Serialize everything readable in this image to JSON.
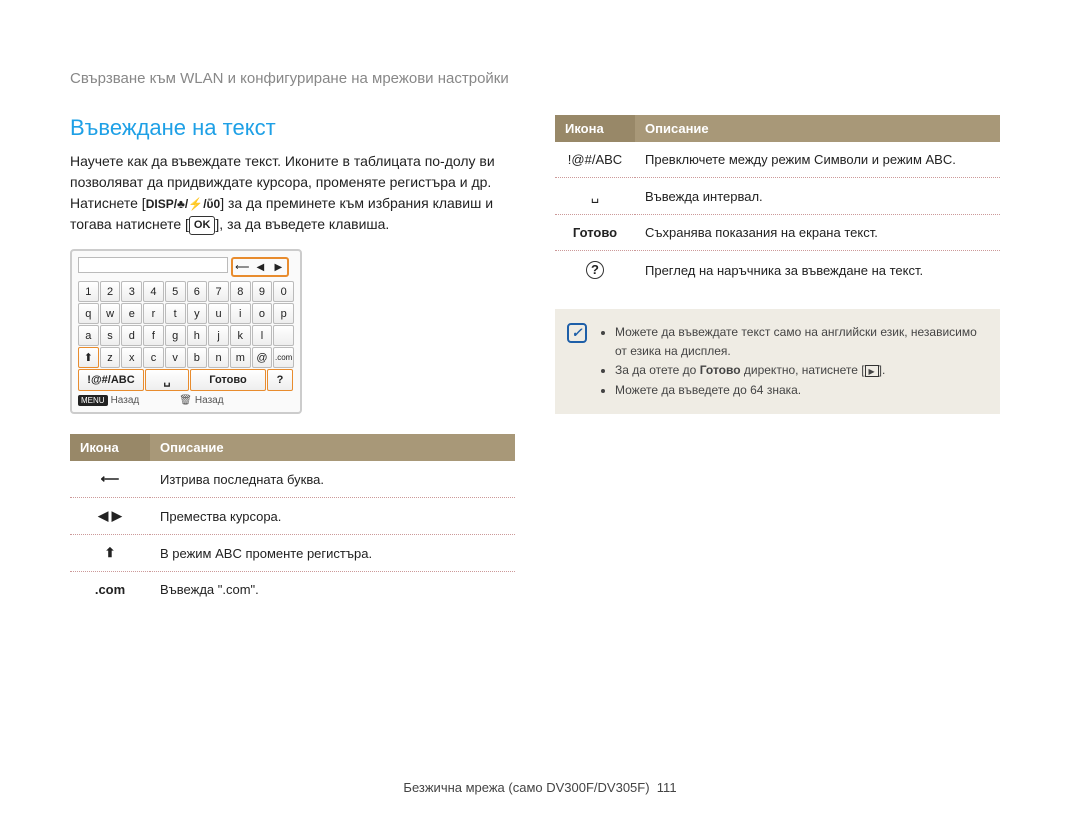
{
  "header": "Свързване към WLAN и конфигуриране на мрежови настройки",
  "title": "Въвеждане на текст",
  "intro_a": "Научете как да въвеждате текст. Иконите в таблицата по-долу ви позволяват да придвиждате курсора, променяте регистъра и др. Натиснете [",
  "intro_b": "] за да преминете към избрания клавиш и тогава натиснете [",
  "intro_c": "], за да въведете клавиша.",
  "disp": "DISP/♣/⚡/ὕ0",
  "ok": "OK",
  "keyboard": {
    "rows": [
      [
        "1",
        "2",
        "3",
        "4",
        "5",
        "6",
        "7",
        "8",
        "9",
        "0"
      ],
      [
        "q",
        "w",
        "e",
        "r",
        "t",
        "y",
        "u",
        "i",
        "o",
        "p"
      ],
      [
        "a",
        "s",
        "d",
        "f",
        "g",
        "h",
        "j",
        "k",
        "l",
        ""
      ],
      [
        "⬆",
        "z",
        "x",
        "c",
        "v",
        "b",
        "n",
        "m",
        "@",
        ".com"
      ]
    ],
    "nav": [
      "⟵",
      "◀",
      "▶"
    ],
    "bottom": {
      "mode": "!@#/ABC",
      "space": "␣",
      "done": "Готово",
      "help": "?"
    },
    "foot1": "Назад",
    "foot2": "Назад",
    "menu": "MENU"
  },
  "table_left": {
    "h1": "Икона",
    "h2": "Описание",
    "rows": [
      {
        "icon": "⟵",
        "text": "Изтрива последната буква."
      },
      {
        "icon": "◀ ▶",
        "text": "Премества курсора."
      },
      {
        "icon": "⬆",
        "text": "В режим ABC променте регистъра."
      },
      {
        "icon": ".com",
        "text": "Въвежда \".com\"."
      }
    ]
  },
  "table_right": {
    "h1": "Икона",
    "h2": "Описание",
    "rows": [
      {
        "icon": "!@#/ABC",
        "text": "Превключете между режим Символи и режим ABC."
      },
      {
        "icon": "␣",
        "text": "Въвежда интервал."
      },
      {
        "icon": "Готово",
        "bold": true,
        "text": "Съхранява показания на екрана текст."
      },
      {
        "icon": "?",
        "circle": true,
        "text": "Преглед на наръчника за въвеждане на текст."
      }
    ]
  },
  "notes": [
    "Можете да въвеждате текст само на английски език, независимо от езика на дисплея.",
    "За да отете до <b>Готово</b> директно, натиснете [<span class='play-icon'>▶</span>].",
    "Можете да въведете до 64 знака."
  ],
  "footer": "Безжична мрежа (само DV300F/DV305F)",
  "page_num": "111"
}
